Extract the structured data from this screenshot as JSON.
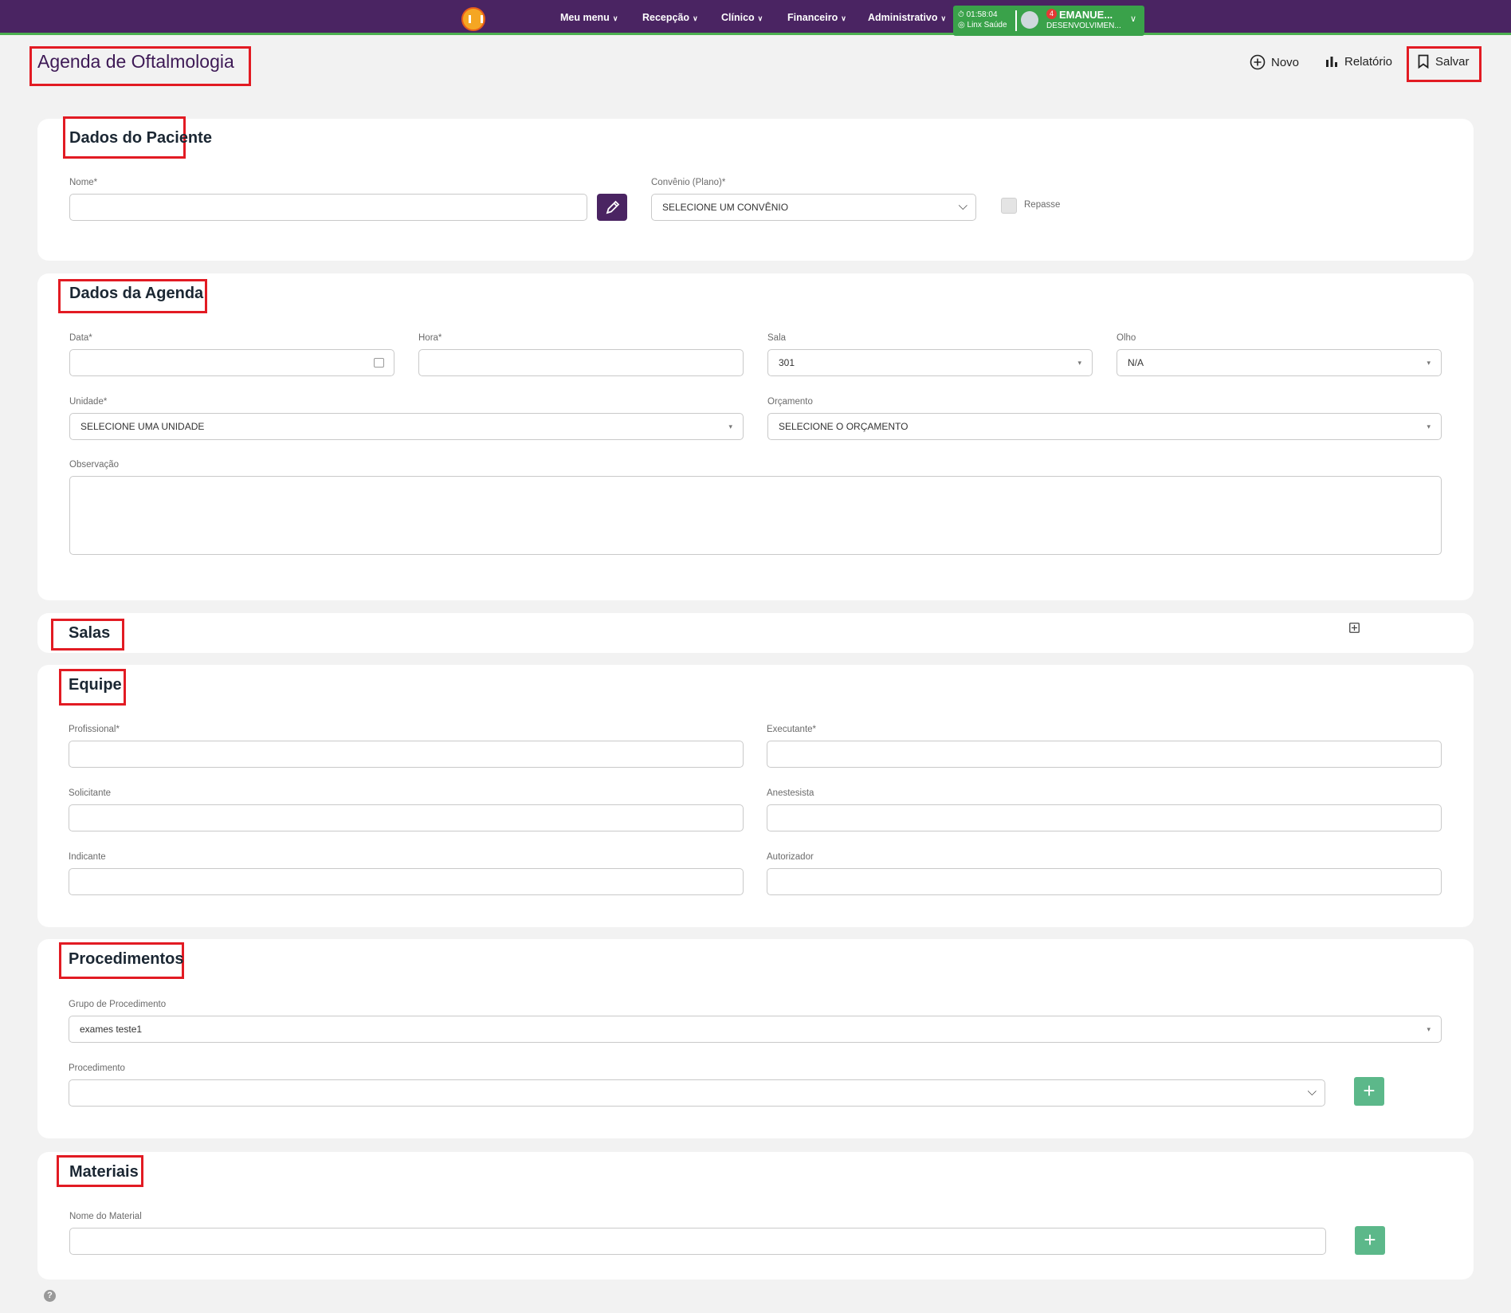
{
  "topbar": {
    "nav": [
      {
        "label": "Meu menu"
      },
      {
        "label": "Recepção"
      },
      {
        "label": "Clínico"
      },
      {
        "label": "Financeiro"
      },
      {
        "label": "Administrativo"
      }
    ],
    "clock": "01:58:04",
    "location": "Linx Saúde",
    "notifications": "4",
    "user_name": "EMANUE...",
    "user_org": "DESENVOLVIMEN...",
    "colors": {
      "bar": "#4a2462",
      "accent": "#4caf50",
      "user_box": "#3aa24a"
    }
  },
  "page": {
    "title": "Agenda de Oftalmologia",
    "actions": {
      "novo": "Novo",
      "relatorio": "Relatório",
      "salvar": "Salvar"
    },
    "help": "?"
  },
  "paciente": {
    "title": "Dados do Paciente",
    "nome_label": "Nome*",
    "nome_value": "",
    "convenio_label": "Convênio (Plano)*",
    "convenio_value": "SELECIONE UM CONVÊNIO",
    "repasse_label": "Repasse",
    "repasse_checked": false
  },
  "agenda": {
    "title": "Dados da Agenda",
    "data_label": "Data*",
    "data_value": "",
    "hora_label": "Hora*",
    "hora_value": "",
    "sala_label": "Sala",
    "sala_value": "301",
    "olho_label": "Olho",
    "olho_value": "N/A",
    "unidade_label": "Unidade*",
    "unidade_value": "SELECIONE UMA UNIDADE",
    "orcamento_label": "Orçamento",
    "orcamento_value": "SELECIONE O ORÇAMENTO",
    "observacao_label": "Observação",
    "observacao_value": ""
  },
  "salas": {
    "title": "Salas"
  },
  "equipe": {
    "title": "Equipe",
    "profissional_label": "Profissional*",
    "executante_label": "Executante*",
    "solicitante_label": "Solicitante",
    "anestesista_label": "Anestesista",
    "indicante_label": "Indicante",
    "autorizador_label": "Autorizador"
  },
  "procedimentos": {
    "title": "Procedimentos",
    "grupo_label": "Grupo de Procedimento",
    "grupo_value": "exames teste1",
    "procedimento_label": "Procedimento",
    "procedimento_value": ""
  },
  "materiais": {
    "title": "Materiais",
    "nome_label": "Nome do Material",
    "nome_value": ""
  }
}
